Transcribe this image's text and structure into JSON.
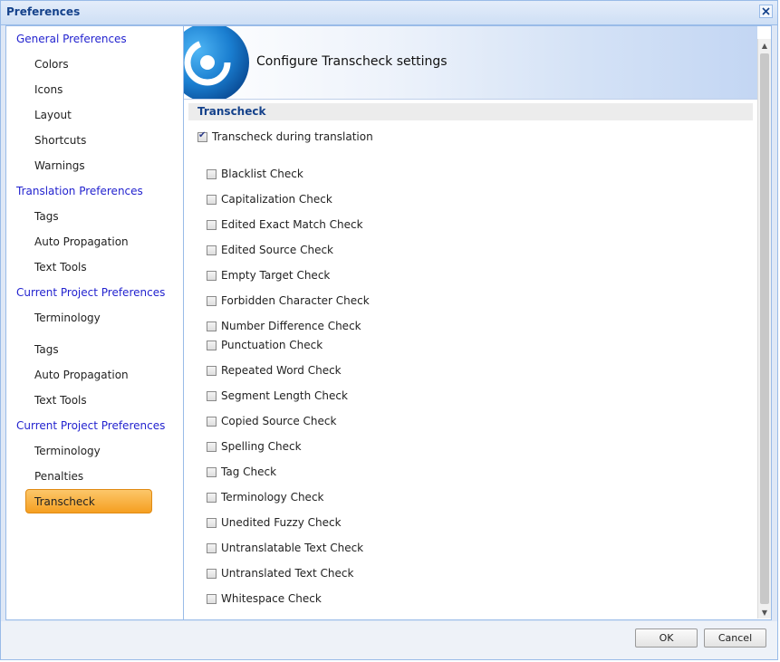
{
  "window": {
    "title": "Preferences",
    "close_icon": "close-icon"
  },
  "sidebar": {
    "items": [
      {
        "label": "General Preferences",
        "kind": "header"
      },
      {
        "label": "Colors",
        "kind": "child"
      },
      {
        "label": "Icons",
        "kind": "child"
      },
      {
        "label": "Layout",
        "kind": "child"
      },
      {
        "label": "Shortcuts",
        "kind": "child"
      },
      {
        "label": "Warnings",
        "kind": "child"
      },
      {
        "label": "Translation Preferences",
        "kind": "header"
      },
      {
        "label": "Tags",
        "kind": "child"
      },
      {
        "label": "Auto Propagation",
        "kind": "child"
      },
      {
        "label": "Text Tools",
        "kind": "child"
      },
      {
        "label": "Current Project Preferences",
        "kind": "header"
      },
      {
        "label": "Terminology",
        "kind": "child"
      },
      {
        "label": "Tags",
        "kind": "child"
      },
      {
        "label": "Auto Propagation",
        "kind": "child"
      },
      {
        "label": "Text Tools",
        "kind": "child"
      },
      {
        "label": "Current Project Preferences",
        "kind": "header"
      },
      {
        "label": "Terminology",
        "kind": "child"
      },
      {
        "label": "Penalties",
        "kind": "child"
      },
      {
        "label": "Transcheck",
        "kind": "child",
        "selected": true
      }
    ]
  },
  "content": {
    "banner_title": "Configure Transcheck settings",
    "section_title": "Transcheck",
    "main_option": {
      "label": "Transcheck during translation",
      "checked": true
    },
    "checks": [
      {
        "label": "Blacklist Check",
        "checked": false
      },
      {
        "label": "Capitalization Check",
        "checked": false
      },
      {
        "label": "Edited Exact Match Check",
        "checked": false
      },
      {
        "label": "Edited Source Check",
        "checked": false
      },
      {
        "label": "Empty Target Check",
        "checked": false
      },
      {
        "label": "Forbidden Character Check",
        "checked": false
      },
      {
        "label": "Number Difference Check",
        "checked": false
      },
      {
        "label": "Punctuation Check",
        "checked": false
      },
      {
        "label": "Repeated Word Check",
        "checked": false
      },
      {
        "label": "Segment Length Check",
        "checked": false
      },
      {
        "label": "Copied Source Check",
        "checked": false
      },
      {
        "label": "Spelling Check",
        "checked": false
      },
      {
        "label": "Tag Check",
        "checked": false
      },
      {
        "label": "Terminology Check",
        "checked": false
      },
      {
        "label": "Unedited Fuzzy Check",
        "checked": false
      },
      {
        "label": "Untranslatable Text Check",
        "checked": false
      },
      {
        "label": "Untranslated Text Check",
        "checked": false
      },
      {
        "label": "Whitespace Check",
        "checked": false
      }
    ]
  },
  "footer": {
    "ok_label": "OK",
    "cancel_label": "Cancel"
  },
  "colors": {
    "accent": "#15428b",
    "nav_header": "#2323cf",
    "selected": "#f5a623",
    "border": "#99bbe8"
  }
}
